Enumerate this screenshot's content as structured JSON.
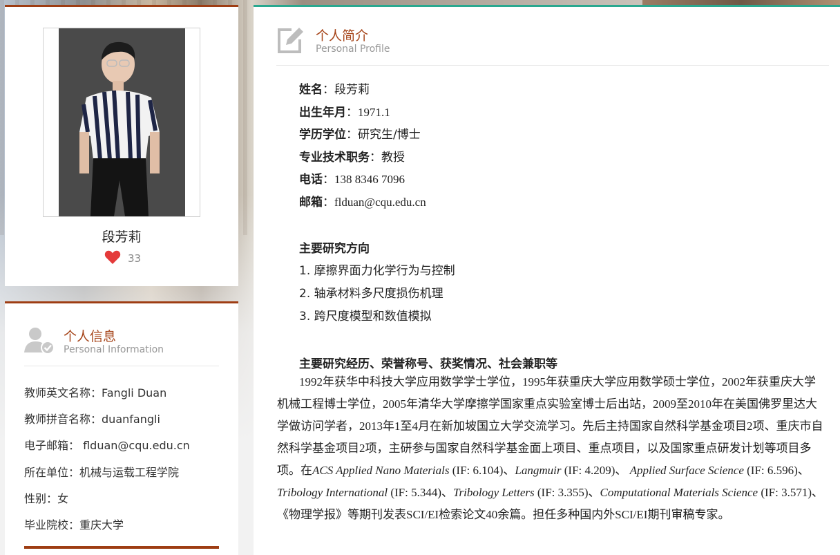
{
  "profile_card": {
    "name": "段芳莉",
    "likes": "33"
  },
  "info": {
    "title_cn": "个人信息",
    "title_en": "Personal Information",
    "rows": [
      {
        "key": "教师英文名称：",
        "value": "Fangli Duan"
      },
      {
        "key": "教师拼音名称：",
        "value": "duanfangli"
      },
      {
        "key": "电子邮箱：",
        "value": " flduan@cqu.edu.cn"
      },
      {
        "key": "所在单位：",
        "value": "机械与运载工程学院"
      },
      {
        "key": "性别：",
        "value": "女"
      },
      {
        "key": "毕业院校：",
        "value": "重庆大学"
      }
    ]
  },
  "main": {
    "title_cn": "个人简介",
    "title_en": "Personal Profile",
    "fields": [
      {
        "key": "姓名",
        "sep": "：",
        "value": "段芳莉"
      },
      {
        "key": "出生年月",
        "sep": "：",
        "value": "1971.1"
      },
      {
        "key": "学历学位",
        "sep": "：",
        "value": "研究生/博士"
      },
      {
        "key": "专业技术职务",
        "sep": "：",
        "value": "教授"
      },
      {
        "key": "电话",
        "sep": "：",
        "value": "138 8346 7096"
      },
      {
        "key": "邮箱",
        "sep": "：",
        "value": "flduan@cqu.edu.cn"
      }
    ],
    "research_heading": "主要研究方向",
    "research_items": [
      "1. 摩擦界面力化学行为与控制",
      "2. 轴承材料多尺度损伤机理",
      "3. 跨尺度模型和数值模拟"
    ],
    "experience_heading": "主要研究经历、荣誉称号、获奖情况、社会兼职等",
    "bio": {
      "p1": "1992年获华中科技大学应用数学学士学位，1995年获重庆大学应用数学硕士学位，2002年获重庆大学机械工程博士学位，2005年清华大学摩擦学国家重点实验室博士后出站，2009至2010年在美国佛罗里达大学做访问学者，2013年1至4月在新加坡国立大学交流学习。先后主持国家自然科学基金项目2项、重庆市自然科学基金项目2项，主研参与国家自然科学基金面上项目、重点项目，以及国家重点研发计划等项目多项。在",
      "j1": "ACS Applied Nano Materials",
      "if1": " (IF: 6.104)、",
      "j2": "Langmuir",
      "if2": " (IF: 4.209)、 ",
      "j3": "Applied Surface Science",
      "if3": " (IF: 6.596)、",
      "j4": "Tribology International",
      "if4": " (IF: 5.344)、",
      "j5": "Tribology Letters",
      "if5": " (IF: 3.355)、",
      "j6": "Computational Materials Science",
      "if6": " (IF: 3.571)、《物理学报》等期刊发表SCI/EI检索论文40余篇。担任多种国内外SCI/EI期刊审稿专家。"
    }
  },
  "colors": {
    "accent_rust": "#9e3d13",
    "accent_teal": "#2aa88f",
    "heart_red": "#e43a3a"
  }
}
